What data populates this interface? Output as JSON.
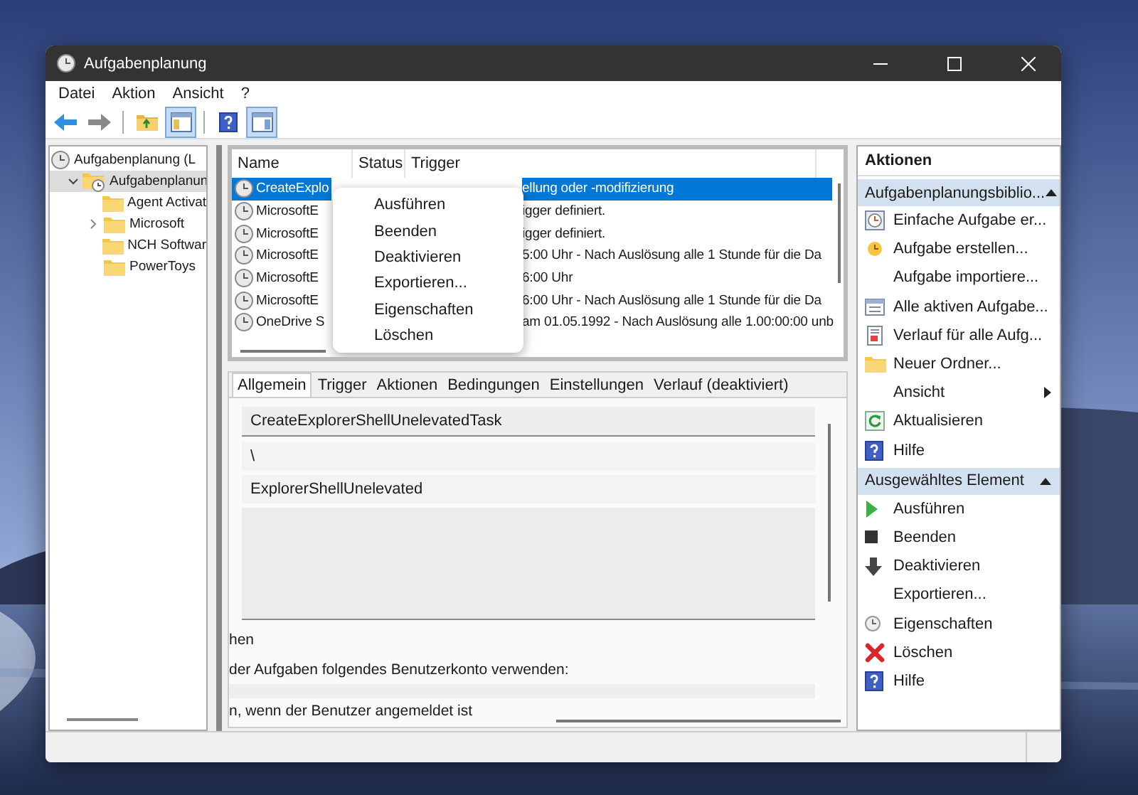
{
  "window": {
    "title": "Aufgabenplanung"
  },
  "menu": [
    "Datei",
    "Aktion",
    "Ansicht",
    "?"
  ],
  "toolbar": [
    {
      "kind": "back",
      "on": false
    },
    {
      "kind": "forward",
      "on": false
    },
    {
      "kind": "separator"
    },
    {
      "kind": "folder-up",
      "on": false
    },
    {
      "kind": "tree-pane",
      "on": true
    },
    {
      "kind": "separator"
    },
    {
      "kind": "help",
      "on": false
    },
    {
      "kind": "action-pane",
      "on": true
    }
  ],
  "tree": [
    {
      "label": "Aufgabenplanung (L",
      "kind": "clock",
      "selected": false,
      "children": [
        {
          "label": "Aufgabenplanun",
          "kind": "folder-clock",
          "selected": true,
          "expanded": true,
          "children": [
            {
              "label": "Agent Activat",
              "kind": "folder",
              "selected": false
            },
            {
              "label": "Microsoft",
              "kind": "folder",
              "selected": false,
              "expanded": false
            },
            {
              "label": "NCH Softwar",
              "kind": "folder",
              "selected": false
            },
            {
              "label": "PowerToys",
              "kind": "folder",
              "selected": false
            }
          ]
        }
      ]
    }
  ],
  "task_list": {
    "columns": [
      "Name",
      "Status",
      "Trigger"
    ],
    "rows": [
      {
        "name": "CreateExplo",
        "trigger": "ellung oder -modifizierung",
        "selected": true
      },
      {
        "name": "MicrosoftE",
        "trigger": "igger definiert.",
        "selected": false
      },
      {
        "name": "MicrosoftE",
        "trigger": "igger definiert.",
        "selected": false
      },
      {
        "name": "MicrosoftE",
        "trigger": "5:00  Uhr - Nach Auslösung alle 1 Stunde für die Da",
        "selected": false
      },
      {
        "name": "MicrosoftE",
        "trigger": "6:00  Uhr",
        "selected": false
      },
      {
        "name": "MicrosoftE",
        "trigger": "6:00  Uhr - Nach Auslösung alle 1 Stunde für die Da",
        "selected": false
      },
      {
        "name": "OneDrive S",
        "trigger": "am 01.05.1992 - Nach Auslösung alle 1.00:00:00 unb",
        "selected": false
      }
    ]
  },
  "context_menu": [
    "Ausführen",
    "Beenden",
    "Deaktivieren",
    "Exportieren...",
    "Eigenschaften",
    "Löschen"
  ],
  "details": {
    "tabs": [
      {
        "label": "Allgemein",
        "selected": true
      },
      {
        "label": "Trigger",
        "selected": false
      },
      {
        "label": "Aktionen",
        "selected": false
      },
      {
        "label": "Bedingungen",
        "selected": false
      },
      {
        "label": "Einstellungen",
        "selected": false
      },
      {
        "label": "Verlauf (deaktiviert)",
        "selected": false
      }
    ],
    "name_field": "CreateExplorerShellUnelevatedTask",
    "location_field": "\\",
    "author_field": "ExplorerShellUnelevated",
    "group_title": "hen",
    "account_text": "der Aufgaben folgendes Benutzerkonto verwenden:",
    "option_text": "n, wenn der Benutzer angemeldet ist"
  },
  "actions": {
    "title": "Aktionen",
    "sections": [
      {
        "title": "Aufgabenplanungsbiblio...",
        "expanded": true,
        "items": [
          {
            "label": "Einfache Aufgabe er...",
            "kind": "wizard"
          },
          {
            "label": "Aufgabe erstellen...",
            "kind": "task"
          },
          {
            "label": "Aufgabe importiere...",
            "kind": "plain"
          },
          {
            "label": "Alle aktiven Aufgabe...",
            "kind": "list"
          },
          {
            "label": "Verlauf für alle Aufg...",
            "kind": "history"
          },
          {
            "label": "Neuer Ordner...",
            "kind": "folder"
          },
          {
            "label": "Ansicht",
            "kind": "submenu"
          },
          {
            "label": "Aktualisieren",
            "kind": "refresh"
          },
          {
            "label": "Hilfe",
            "kind": "help"
          }
        ]
      },
      {
        "title": "Ausgewähltes Element",
        "expanded": true,
        "items": [
          {
            "label": "Ausführen",
            "kind": "run"
          },
          {
            "label": "Beenden",
            "kind": "stop"
          },
          {
            "label": "Deaktivieren",
            "kind": "disable"
          },
          {
            "label": "Exportieren...",
            "kind": "plain"
          },
          {
            "label": "Eigenschaften",
            "kind": "properties"
          },
          {
            "label": "Löschen",
            "kind": "delete"
          },
          {
            "label": "Hilfe",
            "kind": "help"
          }
        ]
      }
    ]
  }
}
